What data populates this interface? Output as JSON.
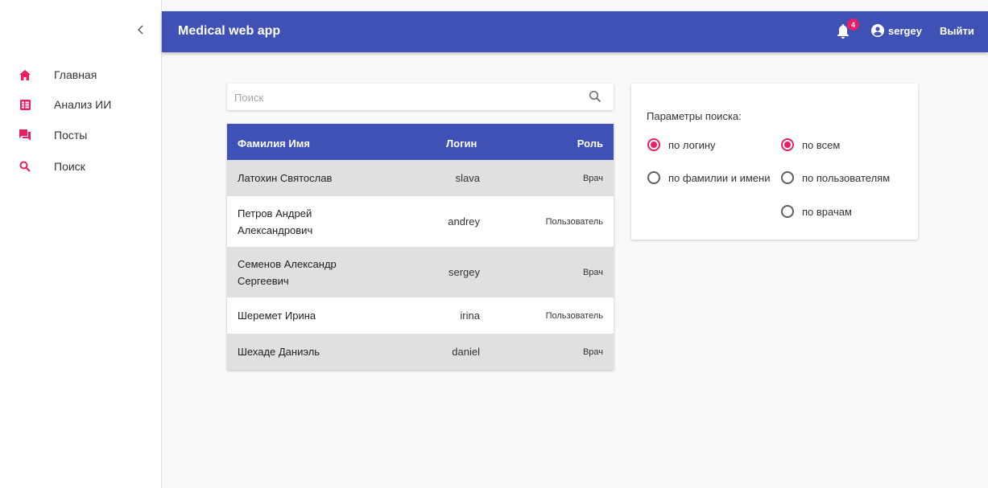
{
  "app": {
    "title": "Medical web app"
  },
  "header": {
    "notifications_count": "4",
    "username": "sergey",
    "logout_label": "Выйти"
  },
  "sidebar": {
    "items": [
      {
        "label": "Главная",
        "icon": "home-icon"
      },
      {
        "label": "Анализ ИИ",
        "icon": "assessment-icon"
      },
      {
        "label": "Посты",
        "icon": "forum-icon"
      },
      {
        "label": "Поиск",
        "icon": "search-icon"
      }
    ]
  },
  "search": {
    "placeholder": "Поиск",
    "value": ""
  },
  "table": {
    "columns": {
      "name": "Фамилия Имя",
      "login": "Логин",
      "role": "Роль"
    },
    "rows": [
      {
        "name": "Латохин Святослав",
        "login": "slava",
        "role": "Врач"
      },
      {
        "name": "Петров Андрей Александрович",
        "login": "andrey",
        "role": "Пользователь"
      },
      {
        "name": "Семенов Александр Сергеевич",
        "login": "sergey",
        "role": "Врач"
      },
      {
        "name": "Шеремет Ирина",
        "login": "irina",
        "role": "Пользователь"
      },
      {
        "name": "Шехаде Даниэль",
        "login": "daniel",
        "role": "Врач"
      }
    ]
  },
  "params": {
    "title": "Параметры поиска:",
    "by_field": [
      {
        "label": "по логину",
        "checked": true
      },
      {
        "label": "по фамилии и имени",
        "checked": false
      }
    ],
    "by_type": [
      {
        "label": "по всем",
        "checked": true
      },
      {
        "label": "по пользователям",
        "checked": false
      },
      {
        "label": "по врачам",
        "checked": false
      }
    ]
  },
  "colors": {
    "primary": "#3f51b5",
    "accent": "#e91e63",
    "row_alt": "#e0e0e0"
  }
}
